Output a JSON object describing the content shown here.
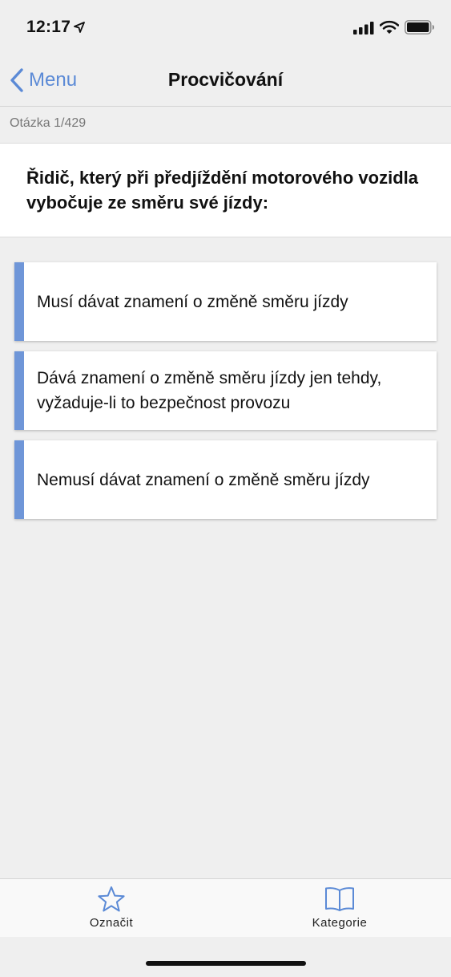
{
  "status_bar": {
    "time": "12:17"
  },
  "nav": {
    "back_label": "Menu",
    "title": "Procvičování"
  },
  "question": {
    "counter": "Otázka 1/429",
    "text": "Řidič, který při předjíždění motorového vozidla vybočuje ze směru své jízdy:"
  },
  "answers": [
    {
      "text": "Musí dávat znamení o změně směru jízdy"
    },
    {
      "text": "Dává znamení o změně směru jízdy jen tehdy, vyžaduje-li to bezpečnost provozu"
    },
    {
      "text": "Nemusí dávat znamení o změně směru jízdy"
    }
  ],
  "tab_bar": {
    "items": [
      {
        "label": "Označit",
        "icon": "star-icon"
      },
      {
        "label": "Kategorie",
        "icon": "book-icon"
      }
    ]
  },
  "colors": {
    "accent": "#5b8ad6",
    "answer_bar": "#6f96d8",
    "background": "#efefef"
  }
}
